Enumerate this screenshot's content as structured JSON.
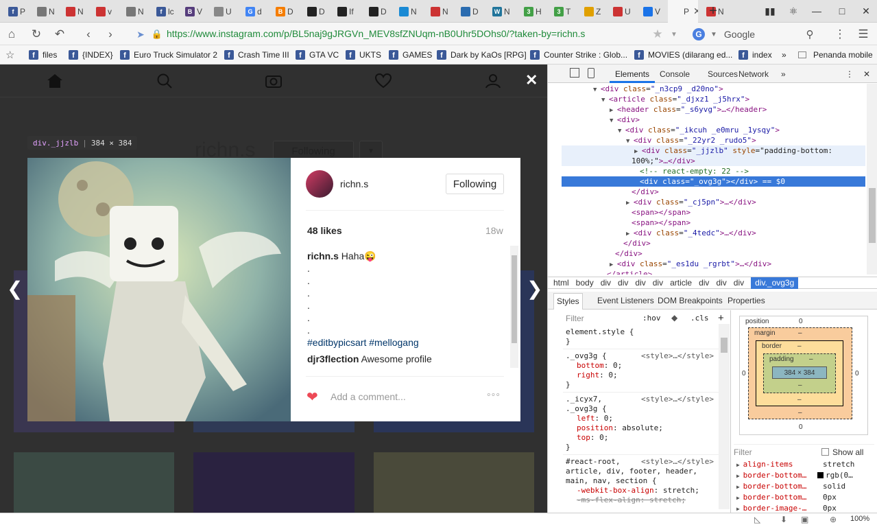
{
  "tabs": [
    {
      "label": "P",
      "color": "#3b5998",
      "glyph": "f"
    },
    {
      "label": "N",
      "color": "#777777",
      "glyph": ""
    },
    {
      "label": "N",
      "color": "#cc3333",
      "glyph": ""
    },
    {
      "label": "v",
      "color": "#cc3333",
      "glyph": ""
    },
    {
      "label": "N",
      "color": "#777777",
      "glyph": ""
    },
    {
      "label": "lc",
      "color": "#3b5998",
      "glyph": "f"
    },
    {
      "label": "V",
      "color": "#563d7c",
      "glyph": "B"
    },
    {
      "label": "U",
      "color": "#888888",
      "glyph": ""
    },
    {
      "label": "d",
      "color": "#4285f4",
      "glyph": "G"
    },
    {
      "label": "D",
      "color": "#f57d00",
      "glyph": "B"
    },
    {
      "label": "D",
      "color": "#222222",
      "glyph": ""
    },
    {
      "label": "If",
      "color": "#222222",
      "glyph": ""
    },
    {
      "label": "D",
      "color": "#222222",
      "glyph": ""
    },
    {
      "label": "N",
      "color": "#1a8ad4",
      "glyph": ""
    },
    {
      "label": "N",
      "color": "#cc3333",
      "glyph": ""
    },
    {
      "label": "D",
      "color": "#2b6cb0",
      "glyph": ""
    },
    {
      "label": "N",
      "color": "#21759b",
      "glyph": "W"
    },
    {
      "label": "H",
      "color": "#43a047",
      "glyph": "3"
    },
    {
      "label": "T",
      "color": "#43a047",
      "glyph": "3"
    },
    {
      "label": "Z",
      "color": "#e0a000",
      "glyph": ""
    },
    {
      "label": "U",
      "color": "#cc3333",
      "glyph": ""
    },
    {
      "label": "V",
      "color": "#1a73e8",
      "glyph": ""
    },
    {
      "label": "P",
      "color": "#f6f6f6",
      "glyph": "",
      "active": true
    },
    {
      "label": "N",
      "color": "#cc3333",
      "glyph": ""
    }
  ],
  "address": {
    "url": "https://www.instagram.com/p/BL5naj9gJRGVn_MEV8sfZNUqm-nB0Uhr5DOhs0/?taken-by=richn.s",
    "search_placeholder": "Google",
    "search_engine_letter": "G"
  },
  "bookmarks": [
    {
      "label": "files"
    },
    {
      "label": "{INDEX}"
    },
    {
      "label": "Euro Truck Simulator 2"
    },
    {
      "label": "Crash Time III"
    },
    {
      "label": "GTA VC"
    },
    {
      "label": "UKTS"
    },
    {
      "label": "GAMES"
    },
    {
      "label": "Dark by KaOs [RPG]"
    },
    {
      "label": "Counter Strike : Glob..."
    },
    {
      "label": "MOVIES (dilarang ed..."
    },
    {
      "label": "index"
    }
  ],
  "bookmarks_more": "»",
  "bookmarks_mobile": "Penanda mobile",
  "instagram": {
    "bg_profile_name": "richn.s",
    "bg_following": "Following",
    "hover_tooltip": {
      "class": "div._jjzlb",
      "size": "384 × 384"
    },
    "post": {
      "username": "richn.s",
      "follow_label": "Following",
      "likes": "48 likes",
      "age": "18w",
      "caption_user": "richn.s",
      "caption_text": "Haha😜",
      "dots": [
        ".",
        ".",
        ".",
        ".",
        ".",
        "."
      ],
      "hashtags": "#editbypicsart #mellogang",
      "comment_user": "djr3flection",
      "comment_text": "Awesome profile",
      "add_comment_placeholder": "Add a comment...",
      "more_label": "◦◦◦"
    }
  },
  "devtools": {
    "tabs": [
      "Elements",
      "Console",
      "Sources",
      "Network"
    ],
    "more_tabs": "»",
    "dom_lines": [
      {
        "indent": 66,
        "arrow": "▼",
        "html": "<div class=\"_n3cp9 _d20no\">"
      },
      {
        "indent": 78,
        "arrow": "▼",
        "html": "<article class=\"_djxz1 _j5hrx\">"
      },
      {
        "indent": 90,
        "arrow": "▶",
        "html": "<header class=\"_s6yvg\">…</header>"
      },
      {
        "indent": 90,
        "arrow": "▼",
        "html": "<div>"
      },
      {
        "indent": 102,
        "arrow": "▼",
        "html": "<div class=\"_ikcuh _e0mru _1ysqy\">"
      },
      {
        "indent": 114,
        "arrow": "▼",
        "html": "<div class=\"_22yr2 _rudo5\">"
      },
      {
        "indent": 126,
        "arrow": "▶",
        "html": "<div class=\"_jjzlb\" style=\"padding-bottom:"
      },
      {
        "indent": 122,
        "arrow": "",
        "html": "100%;\">…</div>"
      },
      {
        "indent": 134,
        "arrow": "",
        "html": "<!-- react-empty: 22 -->"
      },
      {
        "indent": 134,
        "arrow": "",
        "html": "<div class=\"_ovg3g\"></div> == $0"
      },
      {
        "indent": 122,
        "arrow": "",
        "html": "</div>"
      },
      {
        "indent": 114,
        "arrow": "▶",
        "html": "<div class=\"_cj5pn\">…</div>"
      },
      {
        "indent": 122,
        "arrow": "",
        "html": "<span></span>"
      },
      {
        "indent": 122,
        "arrow": "",
        "html": "<span></span>"
      },
      {
        "indent": 114,
        "arrow": "▶",
        "html": "<div class=\"_4tedc\">…</div>"
      },
      {
        "indent": 110,
        "arrow": "",
        "html": "</div>"
      },
      {
        "indent": 98,
        "arrow": "",
        "html": "</div>"
      },
      {
        "indent": 90,
        "arrow": "▶",
        "html": "<div class=\"_es1du _rgrbt\">…</div>"
      },
      {
        "indent": 86,
        "arrow": "",
        "html": "</article>"
      }
    ],
    "selected_row_marker": "•••",
    "breadcrumbs": [
      "html",
      "body",
      "div",
      "div",
      "div",
      "div",
      "article",
      "div",
      "div",
      "div",
      "div._ovg3g"
    ],
    "sub_tabs": [
      "Styles",
      "Event Listeners",
      "DOM Breakpoints",
      "Properties"
    ],
    "filter_placeholder": "Filter",
    "hov_label": ":hov",
    "cls_label": ".cls",
    "add_label": "+",
    "style_lines": [
      {
        "t": "sel",
        "text": "element.style {",
        "src": ""
      },
      {
        "t": "sel",
        "text": "}",
        "src": ""
      },
      {
        "t": "sel",
        "text": "._ovg3g {",
        "src": "<style>…</style>"
      },
      {
        "t": "prop",
        "name": "bottom",
        "value": "0;"
      },
      {
        "t": "prop",
        "name": "right",
        "value": "0;"
      },
      {
        "t": "sel",
        "text": "}",
        "src": ""
      },
      {
        "t": "sel",
        "text": "._icyx7,",
        "src": "<style>…</style>"
      },
      {
        "t": "sel",
        "text": "._ovg3g {",
        "src": ""
      },
      {
        "t": "prop",
        "name": "left",
        "value": "0;"
      },
      {
        "t": "prop",
        "name": "position",
        "value": "absolute;"
      },
      {
        "t": "prop",
        "name": "top",
        "value": "0;"
      },
      {
        "t": "sel",
        "text": "}",
        "src": ""
      },
      {
        "t": "sel",
        "text": "#react-root,",
        "src": "<style>…</style>"
      },
      {
        "t": "sel",
        "text": "article, div, footer, header,",
        "src": ""
      },
      {
        "t": "sel",
        "text": "main, nav, section {",
        "src": ""
      },
      {
        "t": "prop",
        "name": "-webkit-box-align",
        "value": "stretch;"
      },
      {
        "t": "strike",
        "name": "-ms-flex-align",
        "value": "stretch;"
      }
    ],
    "box_model": {
      "position_label": "position",
      "position_value": "0",
      "margin_label": "margin",
      "border_label": "border",
      "padding_label": "padding",
      "content": "384 × 384",
      "dash": "–",
      "zero": "0"
    },
    "computed_filter": "Filter",
    "show_all": "Show all",
    "computed": [
      {
        "name": "align-items",
        "value": "stretch"
      },
      {
        "name": "border-bottom…",
        "value": "rgb(0…"
      },
      {
        "name": "border-bottom…",
        "value": "solid"
      },
      {
        "name": "border-bottom…",
        "value": "0px"
      },
      {
        "name": "border-image-…",
        "value": "0px"
      }
    ]
  },
  "status": {
    "zoom": "100%"
  },
  "colors": {
    "accent": "#1a73e8",
    "selected": "#3879d9",
    "heart": "#ed4956",
    "url_green": "#1f8a3a"
  }
}
